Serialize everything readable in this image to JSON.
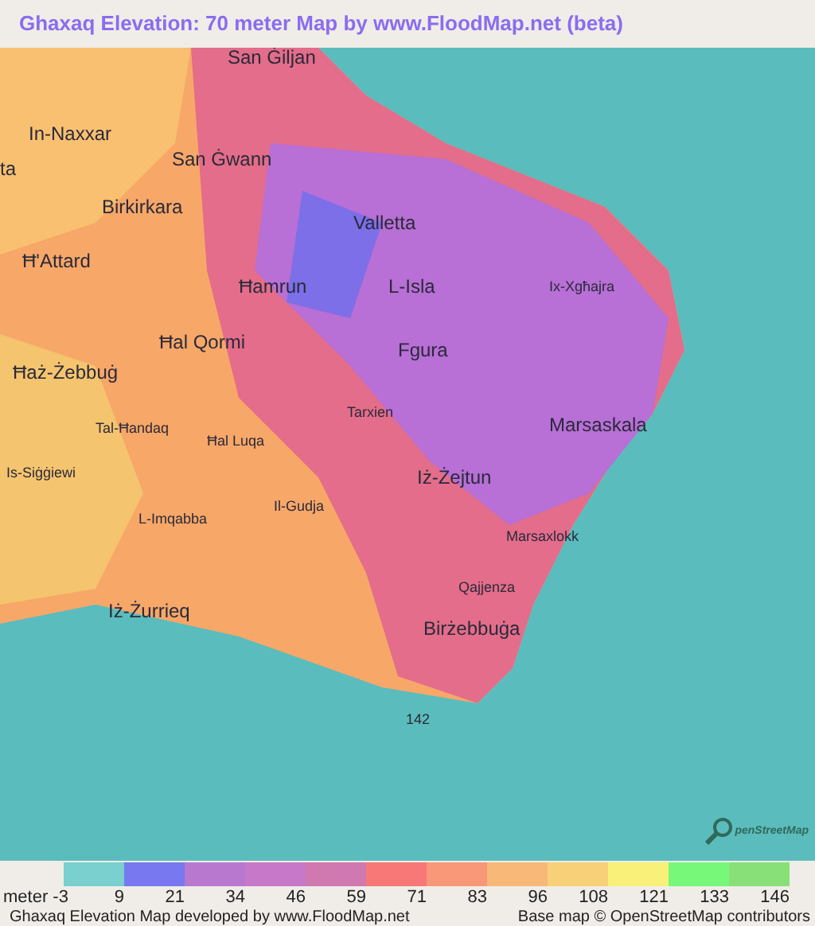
{
  "title": "Ghaxaq Elevation: 70 meter Map by www.FloodMap.net (beta)",
  "map": {
    "places": [
      "San Ġiljan",
      "In-Naxxar",
      "ta",
      "San Ġwann",
      "Birkirkara",
      "Valletta",
      "Ħ'Attard",
      "Ħamrun",
      "L-Isla",
      "Ix-Xgħajra",
      "Ħal Qormi",
      "Fgura",
      "Ħaż-Żebbuġ",
      "Tal-Ħandaq",
      "Tarxien",
      "Marsaskala",
      "Ħal Luqa",
      "Iż-Żejtun",
      "Is-Siġġiewi",
      "Il-Gudja",
      "L-Imqabba",
      "Marsaxlokk",
      "Qajjenza",
      "Iż-Żurrieq",
      "Birżebbuġa",
      "142"
    ],
    "attribution_logo": "penStreetMap"
  },
  "legend": {
    "swatches": [
      {
        "color": "#7acfcf"
      },
      {
        "color": "#7878f0"
      },
      {
        "color": "#b878d0"
      },
      {
        "color": "#c878c8"
      },
      {
        "color": "#d078b0"
      },
      {
        "color": "#f87878"
      },
      {
        "color": "#f89878"
      },
      {
        "color": "#f8b878"
      },
      {
        "color": "#f8d078"
      },
      {
        "color": "#f8f078"
      },
      {
        "color": "#78f878"
      },
      {
        "color": "#88e078"
      }
    ],
    "labels": [
      "meter -3",
      "9",
      "21",
      "34",
      "46",
      "59",
      "71",
      "83",
      "96",
      "108",
      "121",
      "133",
      "146"
    ]
  },
  "footer": {
    "left": "Ghaxaq Elevation Map developed by www.FloodMap.net",
    "right": "Base map © OpenStreetMap contributors"
  }
}
